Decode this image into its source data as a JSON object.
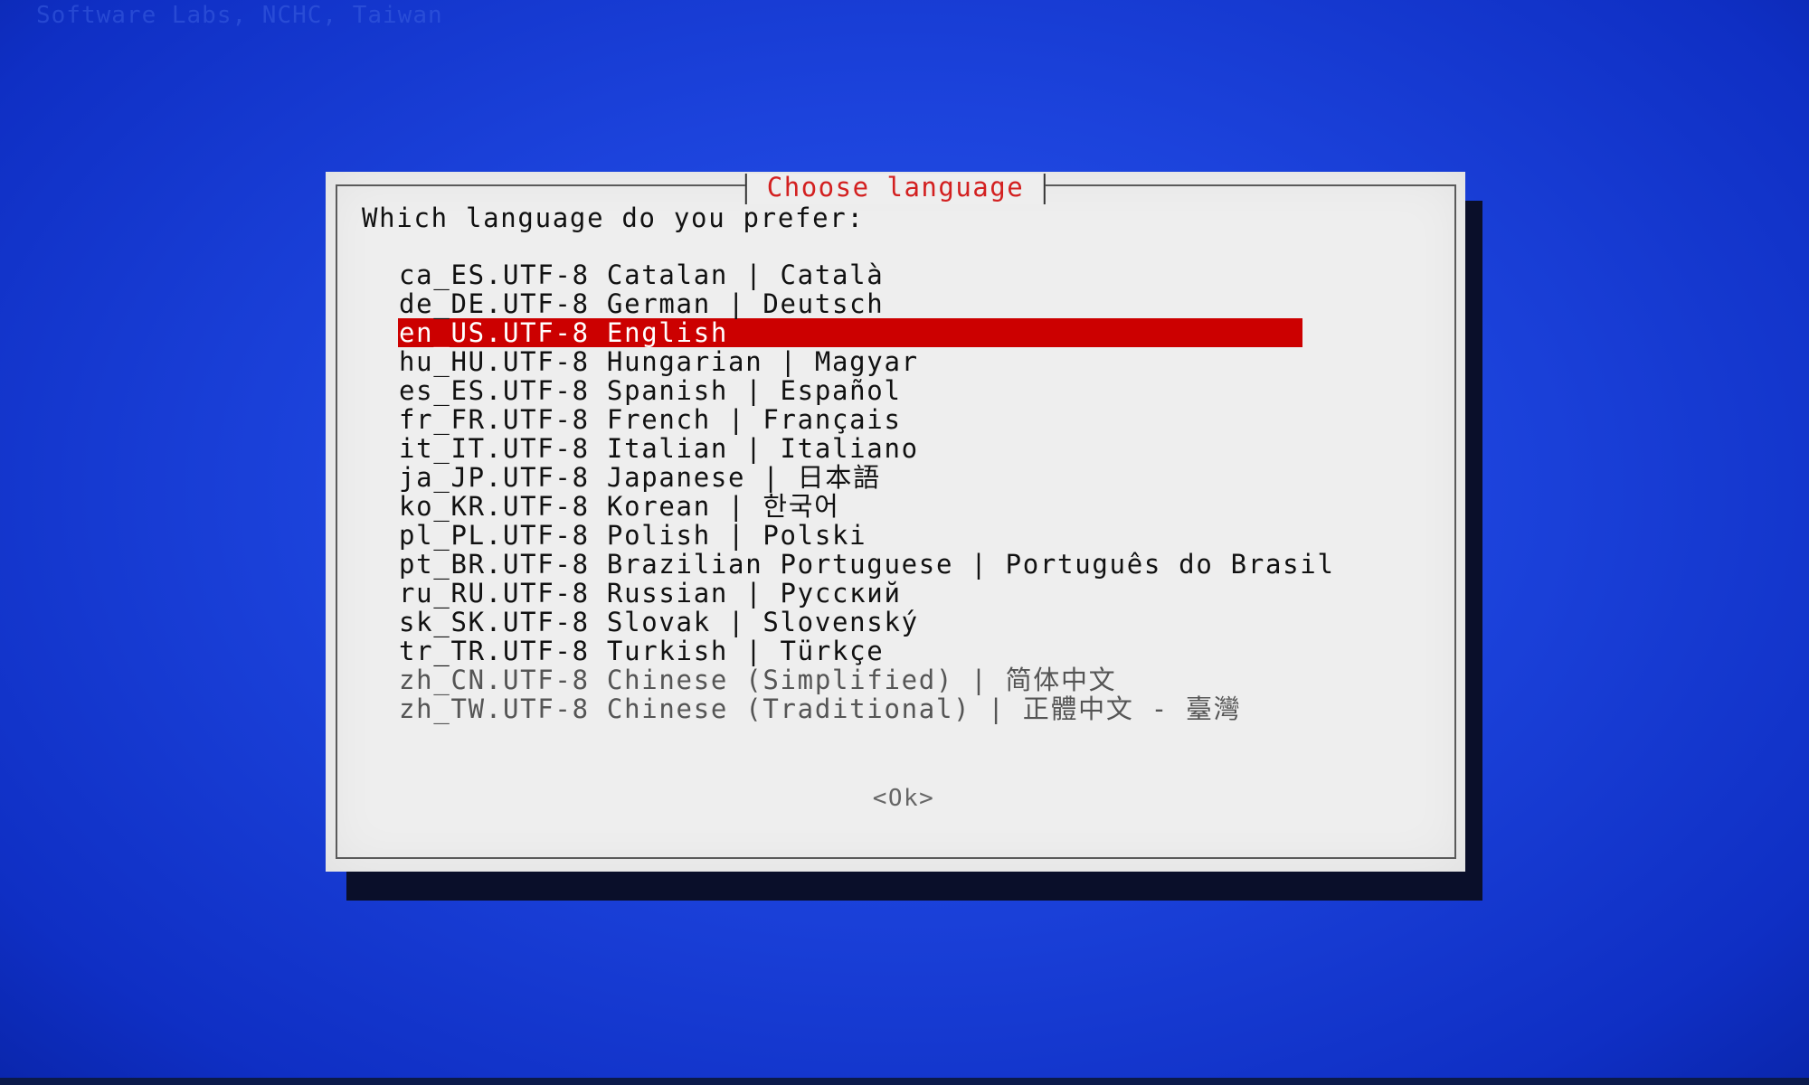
{
  "screen": {
    "title": "Software Labs, NCHC, Taiwan"
  },
  "dialog": {
    "title": "Choose language",
    "prompt": "Which language do you prefer:",
    "selected_index": 2,
    "ok_label": "<Ok>"
  },
  "languages": [
    {
      "label": "ca_ES.UTF-8 Catalan | Català"
    },
    {
      "label": "de_DE.UTF-8 German | Deutsch"
    },
    {
      "label": "en_US.UTF-8 English"
    },
    {
      "label": "hu_HU.UTF-8 Hungarian | Magyar"
    },
    {
      "label": "es_ES.UTF-8 Spanish | Español"
    },
    {
      "label": "fr_FR.UTF-8 French | Français"
    },
    {
      "label": "it_IT.UTF-8 Italian | Italiano"
    },
    {
      "label": "ja_JP.UTF-8 Japanese | 日本語"
    },
    {
      "label": "ko_KR.UTF-8 Korean | 한국어"
    },
    {
      "label": "pl_PL.UTF-8 Polish | Polski"
    },
    {
      "label": "pt_BR.UTF-8 Brazilian Portuguese | Português do Brasil"
    },
    {
      "label": "ru_RU.UTF-8 Russian | Русский"
    },
    {
      "label": "sk_SK.UTF-8 Slovak | Slovenský"
    },
    {
      "label": "tr_TR.UTF-8 Turkish | Türkçe"
    },
    {
      "label": "zh_CN.UTF-8 Chinese (Simplified) | 简体中文"
    },
    {
      "label": "zh_TW.UTF-8 Chinese (Traditional) | 正體中文 - 臺灣"
    }
  ],
  "colors": {
    "background": "#1c43dc",
    "dialog": "#eeeeee",
    "title": "#d32020",
    "highlight": "#cc0000"
  }
}
